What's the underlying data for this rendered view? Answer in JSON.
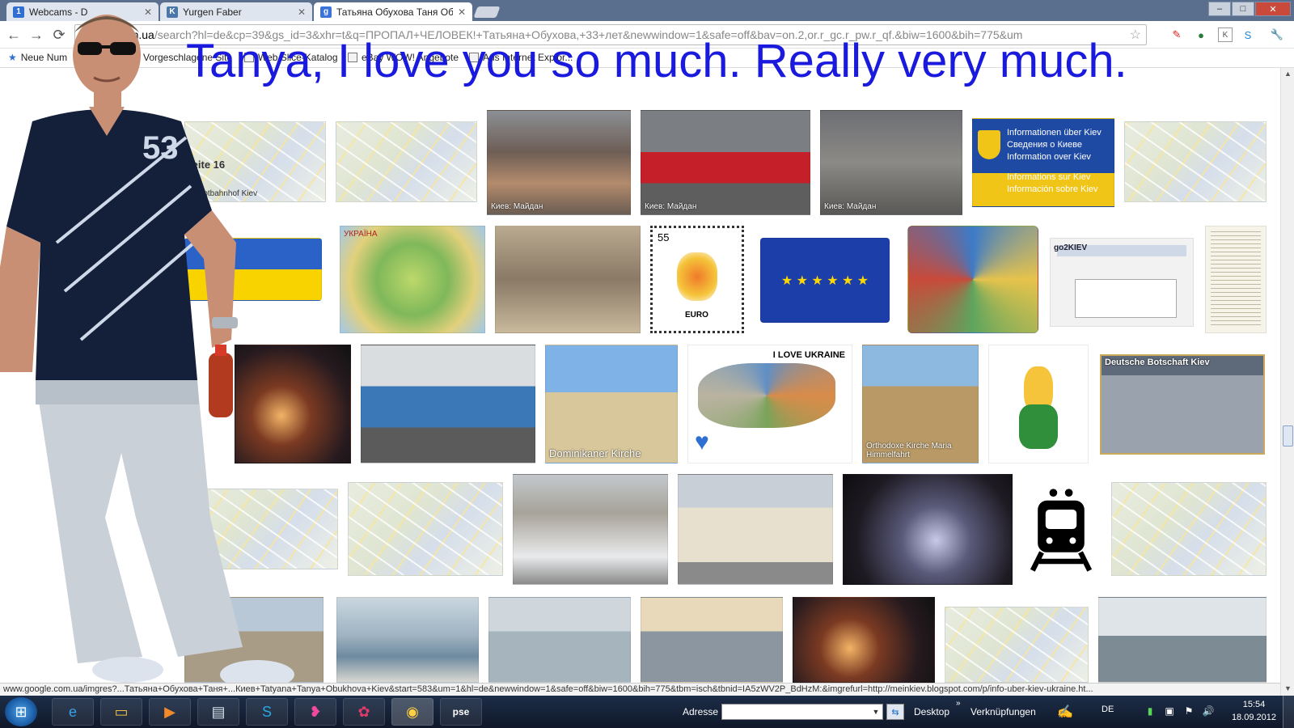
{
  "browser": {
    "tabs": [
      {
        "label": "Webcams - D",
        "favicon": "webcams-favicon",
        "color": "#2f6fd1",
        "glyph": "1",
        "active": false
      },
      {
        "label": "Yurgen Faber",
        "favicon": "vk-favicon",
        "color": "#4a76a8",
        "glyph": "K",
        "active": false
      },
      {
        "label": "Татьяна Обухова Таня Об",
        "favicon": "google-favicon",
        "color": "#3b73d8",
        "glyph": "g",
        "active": true
      }
    ],
    "window_controls": {
      "minimize": "–",
      "maximize": "□",
      "close": "✕"
    },
    "nav": {
      "back": "←",
      "forward": "→",
      "reload": "⟳"
    },
    "url_host": "google.com.ua",
    "url_rest": "/search?hl=de&cp=39&gs_id=3&xhr=t&q=ПРОПАЛ+ЧЕЛОВЕК!+Татьяна+Обухова,+33+лет&newwindow=1&safe=off&bav=on.2,or.r_gc.r_pw.r_qf.&biw=1600&bih=775&um",
    "bookmarks": [
      "Neue Num",
      "Vorgeschlagene Site",
      "Web Slice-Katalog",
      "eBay WOW! Angebote",
      "Aus Internet Explor..."
    ]
  },
  "page": {
    "overlay_text": "Tanya, I love you so much. Really very much.",
    "page_label": "Seite 16",
    "captions": {
      "cam1": "Киев: Майдан",
      "cam2": "Киев: Майдан",
      "cam3": "Киев: Майдан",
      "info_kiev_lines": [
        "Informationen über Kiev",
        "Сведения о Киеве",
        "Information over Kiev",
        "Informations sur Kiev",
        "Información sobre Kiev"
      ],
      "stamp_number": "55",
      "stamp_text": "EURO",
      "ilove": "I LOVE UKRAINE",
      "church1": "Dominikaner Kirche",
      "church2": "Orthodoxe Kirche Maria Himmelfahrt",
      "embassy": "Deutsche Botschaft Kiev",
      "map_label": "Hauptbahnhof Kiev",
      "go2kiev": "go2KIEV",
      "ukraina": "УКРАЇНА"
    }
  },
  "status_url": "www.google.com.ua/imgres?...Татьяна+Обухова+Таня+...Киев+Tatyana+Tanya+Obukhova+Kiev&start=583&um=1&hl=de&newwindow=1&safe=off&biw=1600&bih=775&tbm=isch&tbnid=IA5zWV2P_BdHzM:&imgrefurl=http://meinkiev.blogspot.com/p/info-uber-kiev-ukraine.ht...",
  "taskbar": {
    "address_label": "Adresse",
    "address_value": "",
    "desktop_label": "Desktop",
    "links_label": "Verknüpfungen",
    "language": "DE",
    "time": "15:54",
    "date": "18.09.2012"
  },
  "colors": {
    "overlay_text": "#1a1adf",
    "tabstrip": "#5a6f8e",
    "taskbar": "#10182a"
  }
}
